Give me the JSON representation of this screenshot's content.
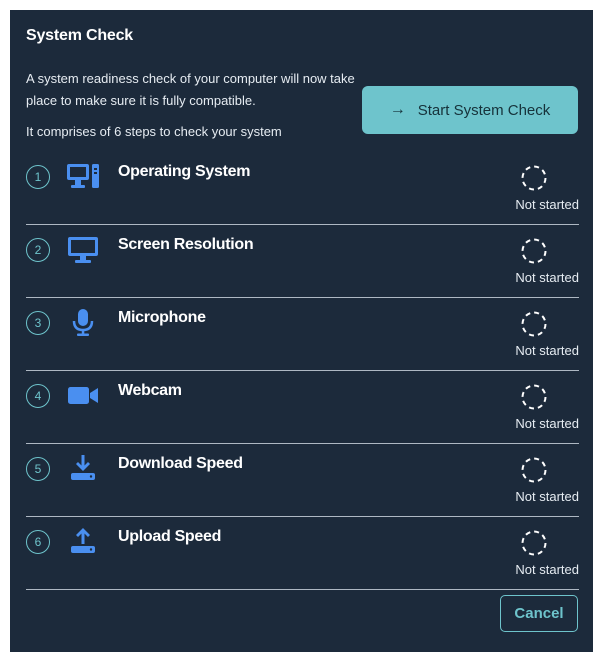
{
  "dialog": {
    "title": "System Check",
    "intro": "A system readiness check of your computer will now take place to make sure it is fully compatible.",
    "steps_note": "It comprises of 6 steps to check your system",
    "start_button": {
      "arrow": "→",
      "label": "Start System Check"
    },
    "cancel_button": "Cancel"
  },
  "steps": [
    {
      "number": "1",
      "icon": "desktop-computer-icon",
      "label": "Operating System",
      "status": "Not started"
    },
    {
      "number": "2",
      "icon": "monitor-icon",
      "label": "Screen Resolution",
      "status": "Not started"
    },
    {
      "number": "3",
      "icon": "microphone-icon",
      "label": "Microphone",
      "status": "Not started"
    },
    {
      "number": "4",
      "icon": "video-camera-icon",
      "label": "Webcam",
      "status": "Not started"
    },
    {
      "number": "5",
      "icon": "download-icon",
      "label": "Download Speed",
      "status": "Not started"
    },
    {
      "number": "6",
      "icon": "upload-icon",
      "label": "Upload Speed",
      "status": "Not started"
    }
  ],
  "colors": {
    "panel_background": "#1c2a3b",
    "accent": "#6ec4cc",
    "icon_blue": "#4a8ff0"
  }
}
